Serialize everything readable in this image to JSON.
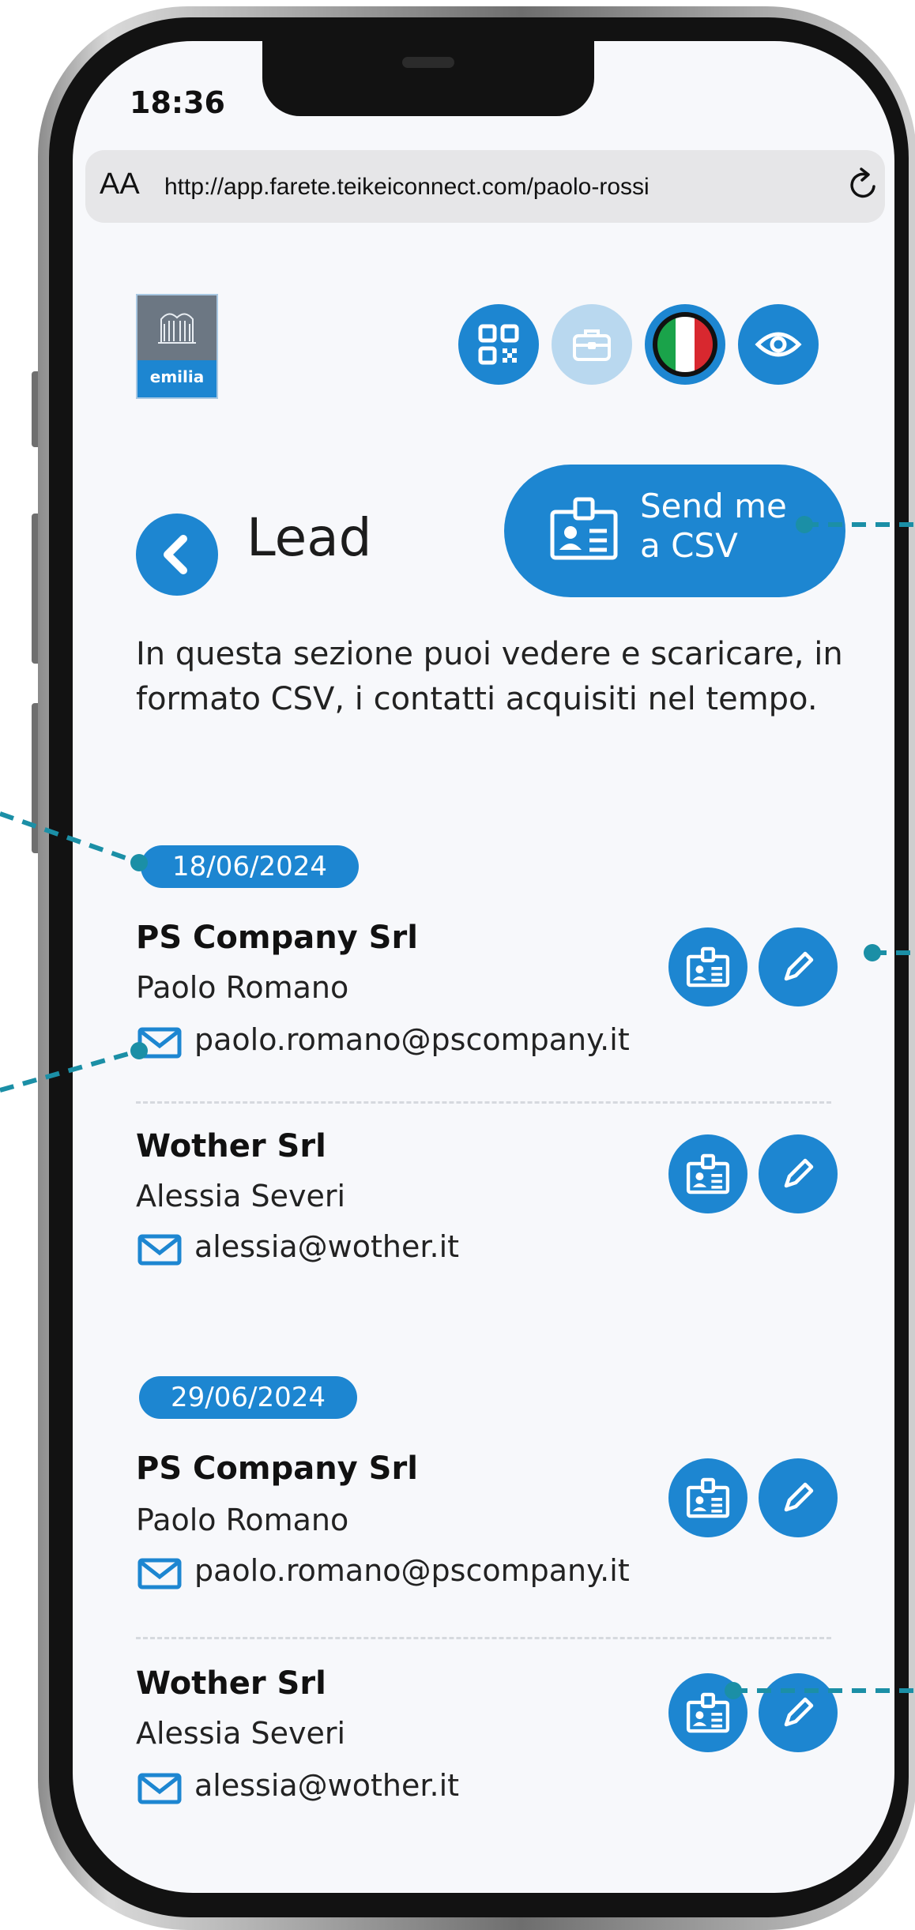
{
  "status_bar": {
    "time": "18:36"
  },
  "browser": {
    "text_size_label": "AA",
    "url": "http://app.farete.teikeiconnect.com/paolo-rossi"
  },
  "header": {
    "logo_text": "emilia",
    "buttons": [
      "qr-code-icon",
      "briefcase-icon",
      "italian-flag-icon",
      "eye-icon"
    ]
  },
  "page": {
    "title": "Lead",
    "csv_button_label": "Send me\na CSV",
    "intro": "In questa sezione puoi vedere e scaricare, in formato CSV, i contatti acquisiti nel tempo."
  },
  "groups": [
    {
      "date": "18/06/2024",
      "leads": [
        {
          "company": "PS Company Srl",
          "name": "Paolo Romano",
          "email": "paolo.romano@pscompany.it"
        },
        {
          "company": "Wother Srl",
          "name": "Alessia Severi",
          "email": "alessia@wother.it"
        }
      ]
    },
    {
      "date": "29/06/2024",
      "leads": [
        {
          "company": "PS Company Srl",
          "name": "Paolo Romano",
          "email": "paolo.romano@pscompany.it"
        },
        {
          "company": "Wother Srl",
          "name": "Alessia Severi",
          "email": "alessia@wother.it"
        }
      ]
    }
  ],
  "colors": {
    "primary": "#1d86d1",
    "disabled": "#b9d8ef",
    "annotation": "#1b8fa6"
  }
}
